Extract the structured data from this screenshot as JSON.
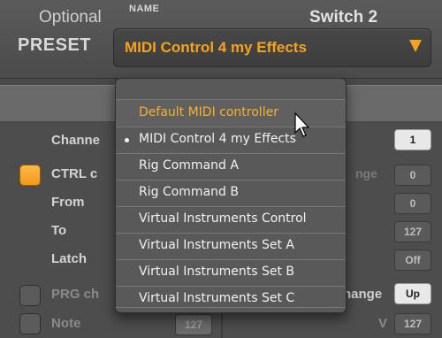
{
  "header": {
    "name_label": "NAME",
    "preset_label": "PRESET",
    "preset_value": "MIDI Control 4 my Effects"
  },
  "tabs": {
    "left_label": "Optional",
    "right_label": "Switch 2"
  },
  "left_panel": {
    "channel_label": "Channe",
    "ctrl_label": "CTRL c",
    "from_label": "From",
    "to_label": "To",
    "latch_label": "Latch",
    "prg_label": "PRG ch",
    "note_label": "Note",
    "note_value": "127"
  },
  "right_panel": {
    "channel_value": "1",
    "ctrl_change_label": "nge",
    "from_value": "0",
    "ctrl_value": "0",
    "to_value": "127",
    "latch_value": "Off",
    "prg_change_label": "hange",
    "prg_value": "Up",
    "v_label": "V",
    "note_value": "127"
  },
  "dropdown": {
    "items": [
      {
        "label": "Default MIDI controller",
        "selected": false,
        "highlighted": true
      },
      {
        "label": "MIDI Control 4 my Effects",
        "selected": true,
        "highlighted": false
      },
      {
        "label": "Rig Command A",
        "selected": false,
        "highlighted": false
      },
      {
        "label": "Rig Command B",
        "selected": false,
        "highlighted": false
      },
      {
        "label": "Virtual Instruments Control",
        "selected": false,
        "highlighted": false
      },
      {
        "label": "Virtual Instruments Set A",
        "selected": false,
        "highlighted": false
      },
      {
        "label": "Virtual Instruments Set B",
        "selected": false,
        "highlighted": false
      },
      {
        "label": "Virtual Instruments Set C",
        "selected": false,
        "highlighted": false
      }
    ]
  },
  "colors": {
    "accent": "#f4a31a",
    "background": "#4a4a4a"
  }
}
